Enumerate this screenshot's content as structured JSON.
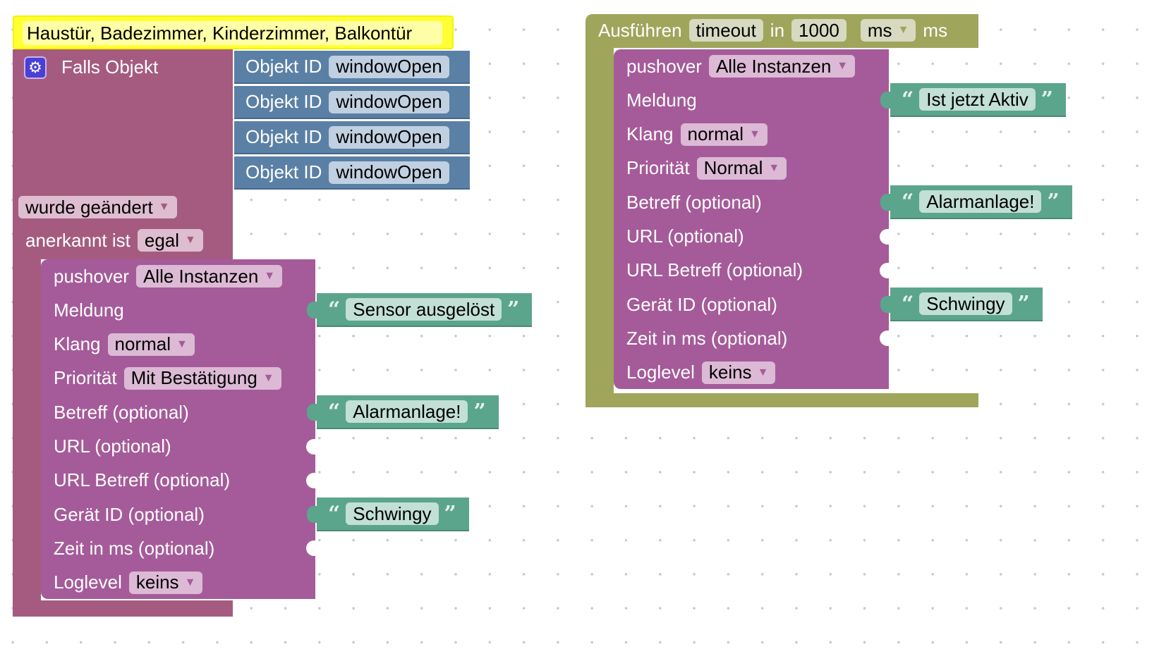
{
  "comment": "Haustür, Badezimmer, Kinderzimmer, Balkontür",
  "trigger": {
    "gear_icon": "gear-icon",
    "label": "Falls Objekt",
    "objects": [
      {
        "label": "Objekt ID",
        "value": "windowOpen"
      },
      {
        "label": "Objekt ID",
        "value": "windowOpen"
      },
      {
        "label": "Objekt ID",
        "value": "windowOpen"
      },
      {
        "label": "Objekt ID",
        "value": "windowOpen"
      }
    ],
    "change": "wurde geändert",
    "ack_label": "anerkannt ist",
    "ack_value": "egal"
  },
  "timeout": {
    "label": "Ausführen",
    "name": "timeout",
    "in_label": "in",
    "value": "1000",
    "unit_dropdown": "ms",
    "unit_label": "ms"
  },
  "pushover_blocks": [
    {
      "rows": [
        {
          "label": "pushover",
          "dropdown": "Alle Instanzen"
        },
        {
          "label": "Meldung",
          "text": "Sensor ausgelöst"
        },
        {
          "label": "Klang",
          "dropdown": "normal"
        },
        {
          "label": "Priorität",
          "dropdown": "Mit Bestätigung"
        },
        {
          "label": "Betreff (optional)",
          "text": "Alarmanlage!"
        },
        {
          "label": "URL (optional)"
        },
        {
          "label": "URL Betreff (optional)"
        },
        {
          "label": "Gerät ID (optional)",
          "text": "Schwingy"
        },
        {
          "label": "Zeit in ms (optional)"
        },
        {
          "label": "Loglevel",
          "dropdown": "keins"
        }
      ]
    },
    {
      "rows": [
        {
          "label": "pushover",
          "dropdown": "Alle Instanzen"
        },
        {
          "label": "Meldung",
          "text": "Ist jetzt Aktiv"
        },
        {
          "label": "Klang",
          "dropdown": "normal"
        },
        {
          "label": "Priorität",
          "dropdown": "Normal"
        },
        {
          "label": "Betreff (optional)",
          "text": "Alarmanlage!"
        },
        {
          "label": "URL (optional)"
        },
        {
          "label": "URL Betreff (optional)"
        },
        {
          "label": "Gerät ID (optional)",
          "text": "Schwingy"
        },
        {
          "label": "Zeit in ms (optional)"
        },
        {
          "label": "Loglevel",
          "dropdown": "keins"
        }
      ]
    }
  ],
  "colors": {
    "trigger": "#a55b80",
    "object_id": "#5b80a5",
    "pushover": "#a55b99",
    "text": "#5ba58c",
    "timeout": "#9fa55b",
    "comment": "#ffff33"
  }
}
